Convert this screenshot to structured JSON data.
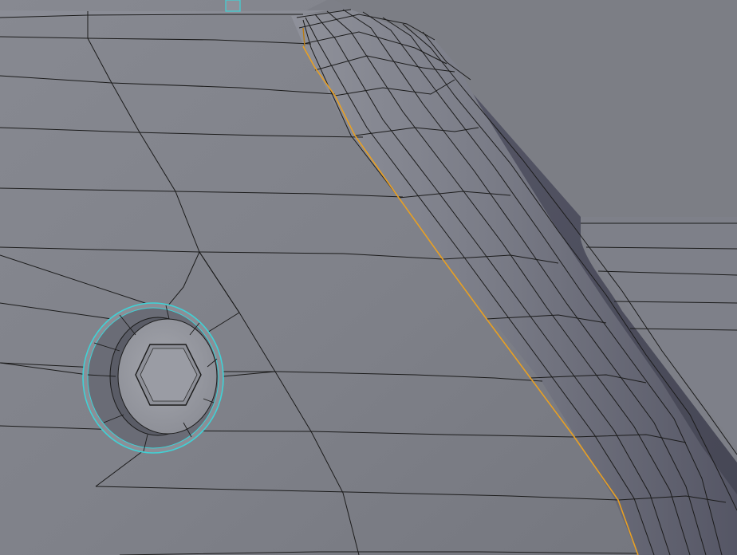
{
  "viewport": {
    "kind": "3d-mesh-edit-view",
    "texts": []
  },
  "colors": {
    "background": "#7d7f87",
    "main_face": "#7f8189",
    "main_face_light": "#868891",
    "main_face_dark": "#74767e",
    "upper_face": "#7b7d84",
    "fillet_light": "#8a8c96",
    "fillet_dark": "#4f5060",
    "wall_dark": "#4a4b59",
    "wireframe": "#1a1a1a",
    "selected_edge": "#e8a024",
    "selected_edge_dark": "#b97d14",
    "hole_outline": "#3fd2d6",
    "hole_inner": "#9fa1a8",
    "hole_wall": "#5a5c66"
  },
  "icons": {
    "hole": "hex-socket-hole-icon"
  }
}
